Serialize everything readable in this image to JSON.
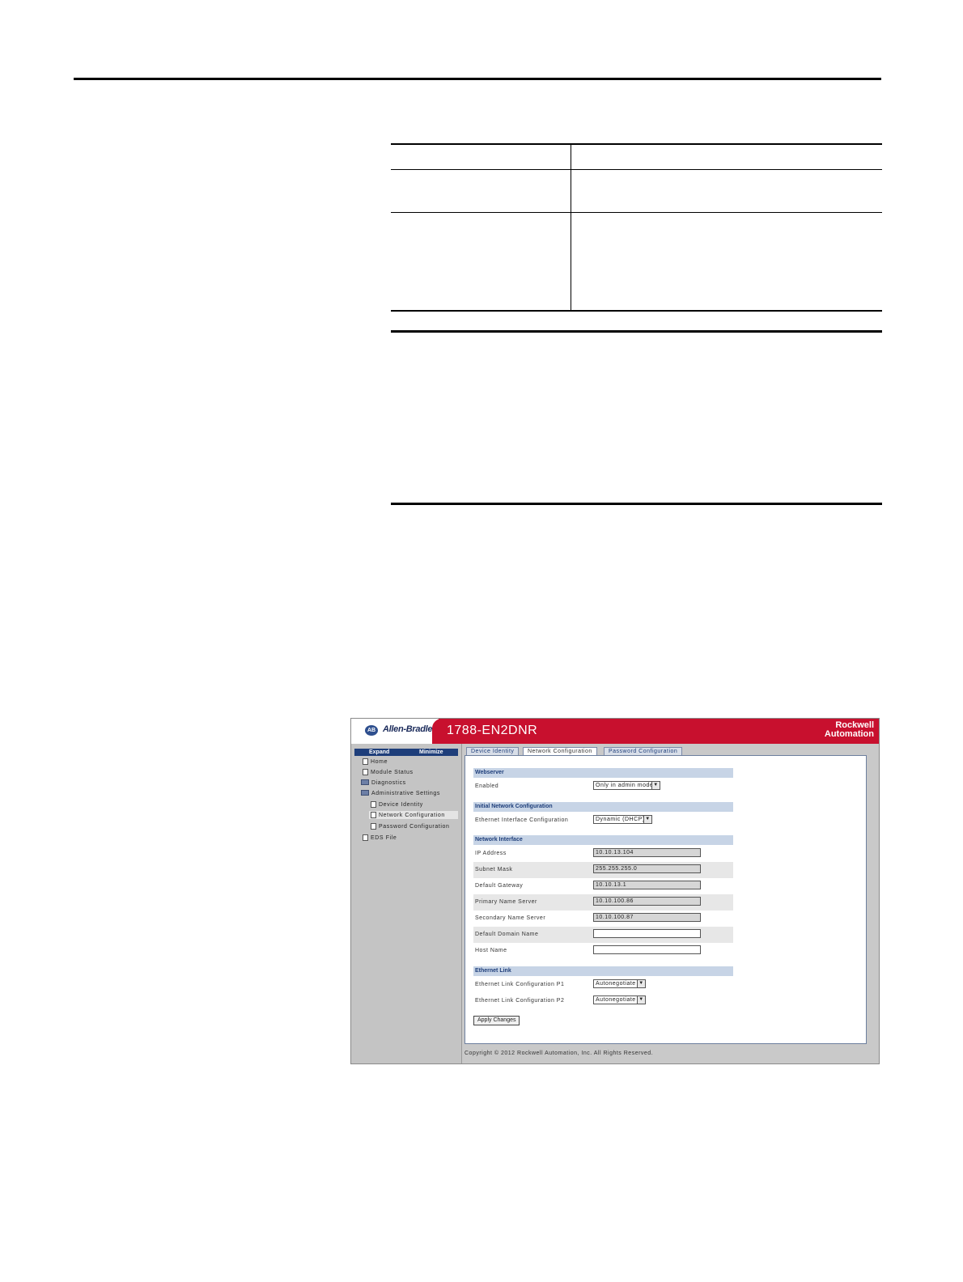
{
  "screenshot": {
    "brand": "Allen-Bradley",
    "brand_badge": "AB",
    "device_title": "1788-EN2DNR",
    "vendor_line1": "Rockwell",
    "vendor_line2": "Automation",
    "nav": {
      "expand": "Expand",
      "minimize": "Minimize",
      "items": [
        {
          "label": "Home"
        },
        {
          "label": "Module Status"
        },
        {
          "label": "Diagnostics"
        },
        {
          "label": "Administrative Settings"
        },
        {
          "label": "Device Identity"
        },
        {
          "label": "Network Configuration"
        },
        {
          "label": "Password Configuration"
        },
        {
          "label": "EDS File"
        }
      ]
    },
    "tabs": [
      "Device Identity",
      "Network Configuration",
      "Password Configuration"
    ],
    "sections": {
      "webserver": "Webserver",
      "initial": "Initial Network Configuration",
      "netif": "Network Interface",
      "link": "Ethernet Link"
    },
    "rows": {
      "enabled": {
        "label": "Enabled",
        "value": "Only in admin mode"
      },
      "eth_if": {
        "label": "Ethernet Interface Configuration",
        "value": "Dynamic (DHCP)"
      },
      "ip": {
        "label": "IP Address",
        "value": "10.10.13.104"
      },
      "mask": {
        "label": "Subnet Mask",
        "value": "255.255.255.0"
      },
      "gw": {
        "label": "Default Gateway",
        "value": "10.10.13.1"
      },
      "dns1": {
        "label": "Primary Name Server",
        "value": "10.10.100.86"
      },
      "dns2": {
        "label": "Secondary Name Server",
        "value": "10.10.100.87"
      },
      "domain": {
        "label": "Default Domain Name",
        "value": ""
      },
      "host": {
        "label": "Host Name",
        "value": ""
      },
      "p1": {
        "label": "Ethernet Link Configuration P1",
        "value": "Autonegotiate"
      },
      "p2": {
        "label": "Ethernet Link Configuration P2",
        "value": "Autonegotiate"
      }
    },
    "apply": "Apply Changes",
    "copyright": "Copyright © 2012 Rockwell Automation, Inc. All Rights Reserved."
  }
}
